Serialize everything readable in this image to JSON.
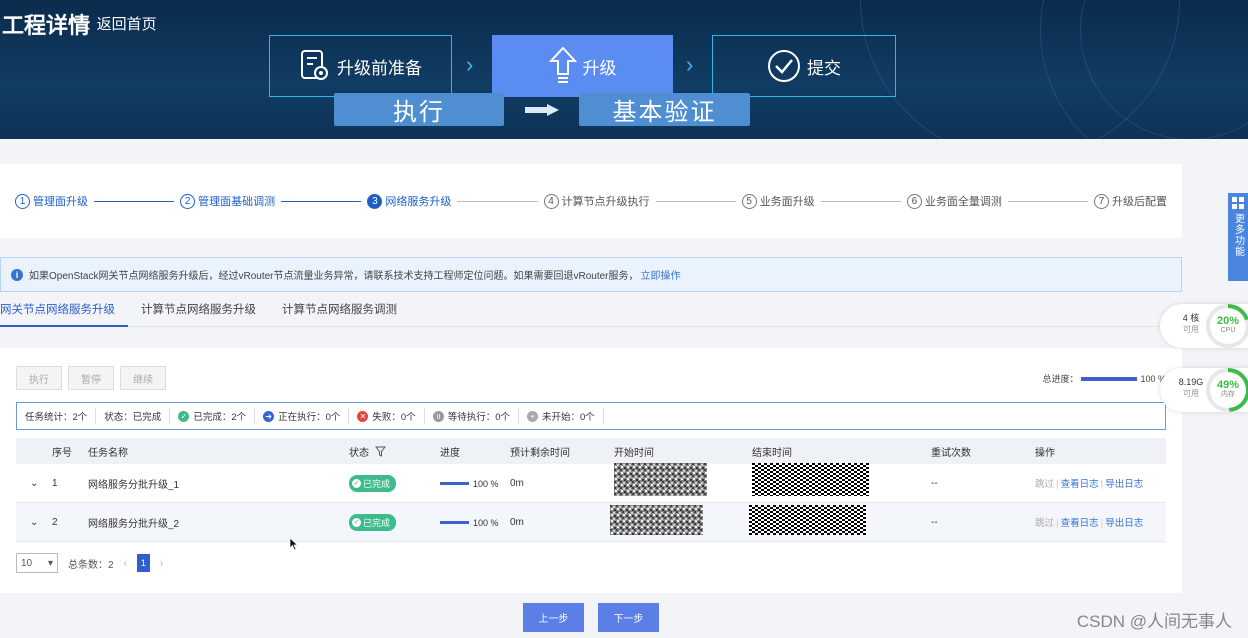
{
  "header": {
    "title": "工程详情",
    "back_label": "返回首页",
    "phases": [
      "升级前准备",
      "升级",
      "提交"
    ],
    "sub_steps": [
      "执行",
      "基本验证"
    ]
  },
  "stepper": [
    {
      "num": "1",
      "label": "管理面升级",
      "state": "done"
    },
    {
      "num": "2",
      "label": "管理面基础调测",
      "state": "done"
    },
    {
      "num": "3",
      "label": "网络服务升级",
      "state": "current"
    },
    {
      "num": "4",
      "label": "计算节点升级执行",
      "state": "todo"
    },
    {
      "num": "5",
      "label": "业务面升级",
      "state": "todo"
    },
    {
      "num": "6",
      "label": "业务面全量调测",
      "state": "todo"
    },
    {
      "num": "7",
      "label": "升级后配置",
      "state": "todo"
    }
  ],
  "info": {
    "text": "如果OpenStack网关节点网络服务升级后，经过vRouter节点流量业务异常，请联系技术支持工程师定位问题。如果需要回退vRouter服务，",
    "link": "立即操作"
  },
  "tabs": [
    "网关节点网络服务升级",
    "计算节点网络服务升级",
    "计算节点网络服务调测"
  ],
  "toolbar": {
    "execute": "执行",
    "pause": "暂停",
    "resume": "继续"
  },
  "overall": {
    "label": "总进度：",
    "value": "100 %"
  },
  "stats": {
    "total": "任务统计：2个",
    "status": "状态：已完成",
    "done": "已完成：2个",
    "running": "正在执行：0个",
    "failed": "失败：0个",
    "waiting": "等待执行：0个",
    "not_started": "未开始：0个"
  },
  "columns": [
    "序号",
    "任务名称",
    "状态",
    "进度",
    "预计剩余时间",
    "开始时间",
    "结束时间",
    "重试次数",
    "操作"
  ],
  "rows": [
    {
      "no": "1",
      "name": "网络服务分批升级_1",
      "status": "已完成",
      "progress": "100 %",
      "remaining": "0m",
      "retries": "--"
    },
    {
      "no": "2",
      "name": "网络服务分批升级_2",
      "status": "已完成",
      "progress": "100 %",
      "remaining": "0m",
      "retries": "--"
    }
  ],
  "ops": {
    "skip": "跳过",
    "view_log": "查看日志",
    "export_log": "导出日志"
  },
  "pager": {
    "size": "10",
    "total": "总条数：2",
    "page": "1"
  },
  "footer": {
    "prev": "上一步",
    "next": "下一步"
  },
  "side": {
    "more": "更多功能",
    "cpu": {
      "value": "4 核",
      "sub": "可用",
      "percent": "20%",
      "name": "CPU"
    },
    "mem": {
      "value": "8.19G",
      "sub": "可用",
      "percent": "49%",
      "name": "内存"
    }
  },
  "watermark": "CSDN @人间无事人",
  "colors": {
    "accent": "#2e5fcf",
    "success": "#3dbb8a",
    "header_bg": "#0d3357"
  }
}
